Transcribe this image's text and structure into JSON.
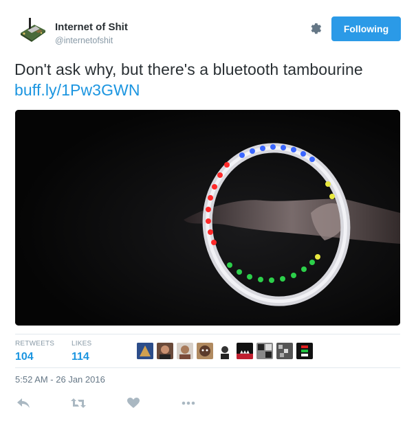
{
  "account": {
    "name": "Internet of Shit",
    "handle": "@internetofshit",
    "avatar_icon": "circuit-board-icon"
  },
  "header": {
    "follow_label": "Following",
    "settings_icon": "gear-icon"
  },
  "tweet": {
    "text_before": "Don't ask why, but there's a bluetooth tambourine",
    "link": "buff.ly/1Pw3GWN",
    "media_description": ""
  },
  "stats": {
    "retweets_label": "RETWEETS",
    "retweets_count": "104",
    "likes_label": "LIKES",
    "likes_count": "114"
  },
  "timestamp": "5:52 AM - 26 Jan 2016",
  "actions": {
    "reply_icon": "reply-icon",
    "retweet_icon": "retweet-icon",
    "like_icon": "heart-icon",
    "more_icon": "more-icon"
  },
  "colors": {
    "accent": "#1b95e0",
    "follow_button": "#2b9ae7",
    "muted": "#8899a6"
  }
}
